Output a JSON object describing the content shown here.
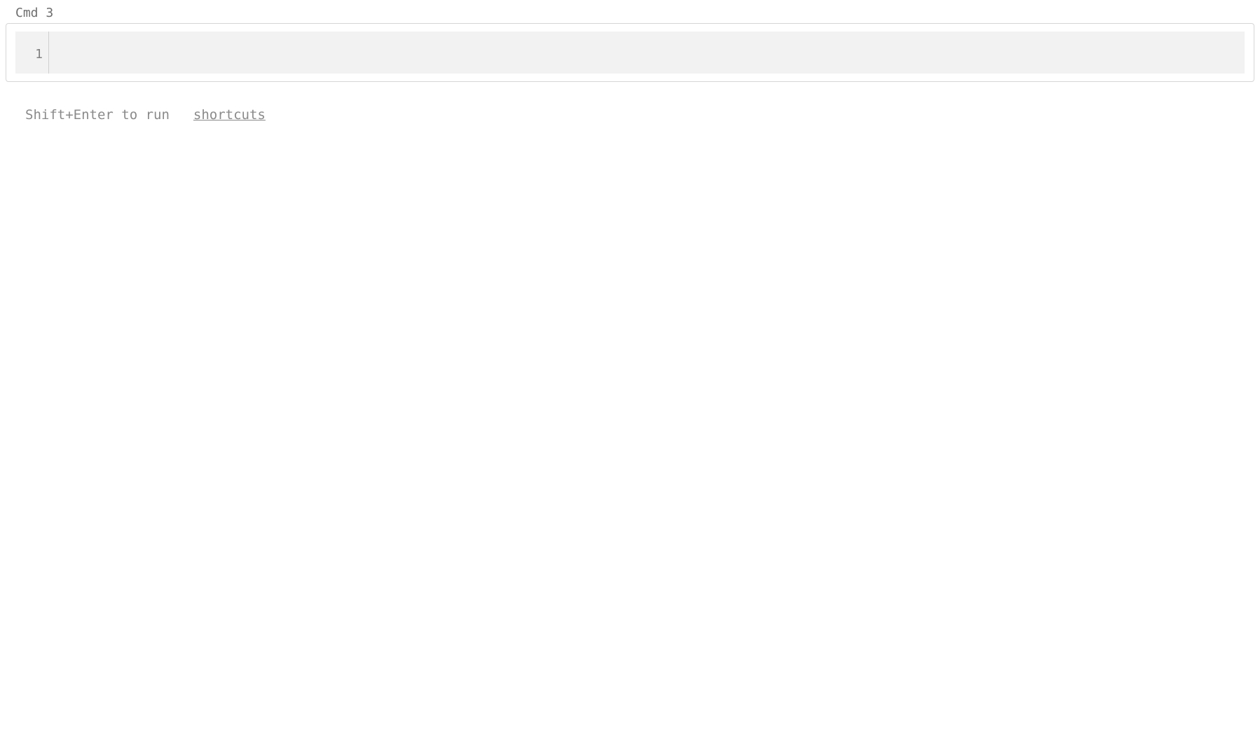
{
  "cell": {
    "label": "Cmd 3",
    "line_number": "1",
    "code_content": ""
  },
  "footer": {
    "run_hint": "Shift+Enter to run",
    "shortcuts_label": "shortcuts"
  }
}
